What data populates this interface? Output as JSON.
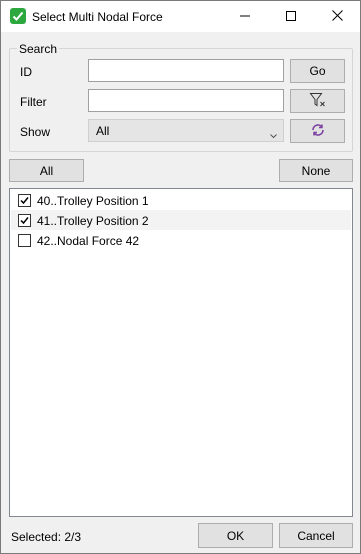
{
  "window": {
    "title": "Select Multi Nodal Force"
  },
  "search": {
    "legend": "Search",
    "id_label": "ID",
    "id_value": "",
    "go_label": "Go",
    "filter_label": "Filter",
    "filter_value": "",
    "show_label": "Show",
    "show_selected": "All"
  },
  "selection": {
    "all_label": "All",
    "none_label": "None"
  },
  "items": [
    {
      "text": "40..Trolley Position 1",
      "checked": true
    },
    {
      "text": "41..Trolley Position 2",
      "checked": true
    },
    {
      "text": "42..Nodal Force 42",
      "checked": false
    }
  ],
  "footer": {
    "status": "Selected: 2/3",
    "ok_label": "OK",
    "cancel_label": "Cancel"
  },
  "colors": {
    "accent": "#2da83f",
    "refresh": "#7b3fa0"
  }
}
